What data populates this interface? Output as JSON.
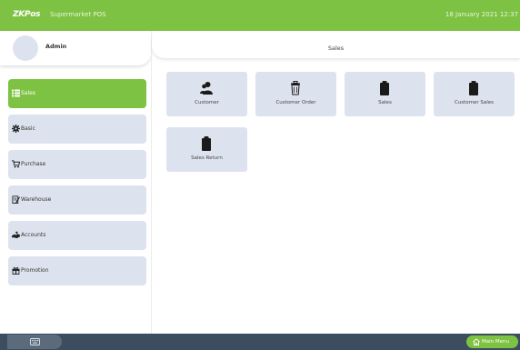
{
  "header": {
    "logo": "ZKPos",
    "app_title": "Supermarket POS",
    "datetime": "18 January 2021 12:37"
  },
  "user": {
    "name": "Admin"
  },
  "sidebar": {
    "items": [
      {
        "label": "Sales",
        "icon": "list-icon",
        "active": true
      },
      {
        "label": "Basic",
        "icon": "gear-icon",
        "active": false
      },
      {
        "label": "Purchase",
        "icon": "cart-icon",
        "active": false
      },
      {
        "label": "Warehouse",
        "icon": "clipboard-pen-icon",
        "active": false
      },
      {
        "label": "Accounts",
        "icon": "handshake-icon",
        "active": false
      },
      {
        "label": "Promotion",
        "icon": "gift-icon",
        "active": false
      }
    ]
  },
  "main": {
    "title": "Sales",
    "tiles": [
      {
        "label": "Customer",
        "icon": "users-icon"
      },
      {
        "label": "Customer Order",
        "icon": "order-trash-icon"
      },
      {
        "label": "Sales",
        "icon": "clipboard-icon"
      },
      {
        "label": "Customer Sales",
        "icon": "clipboard-icon"
      },
      {
        "label": "Sales Return",
        "icon": "clipboard-icon"
      }
    ]
  },
  "footer": {
    "keyboard_icon": "keyboard-icon",
    "main_menu_label": "Main Menu",
    "main_menu_icon": "home-icon"
  },
  "colors": {
    "accent": "#7dc242",
    "tile": "#dde3ee",
    "footer": "#3c4d5f"
  }
}
